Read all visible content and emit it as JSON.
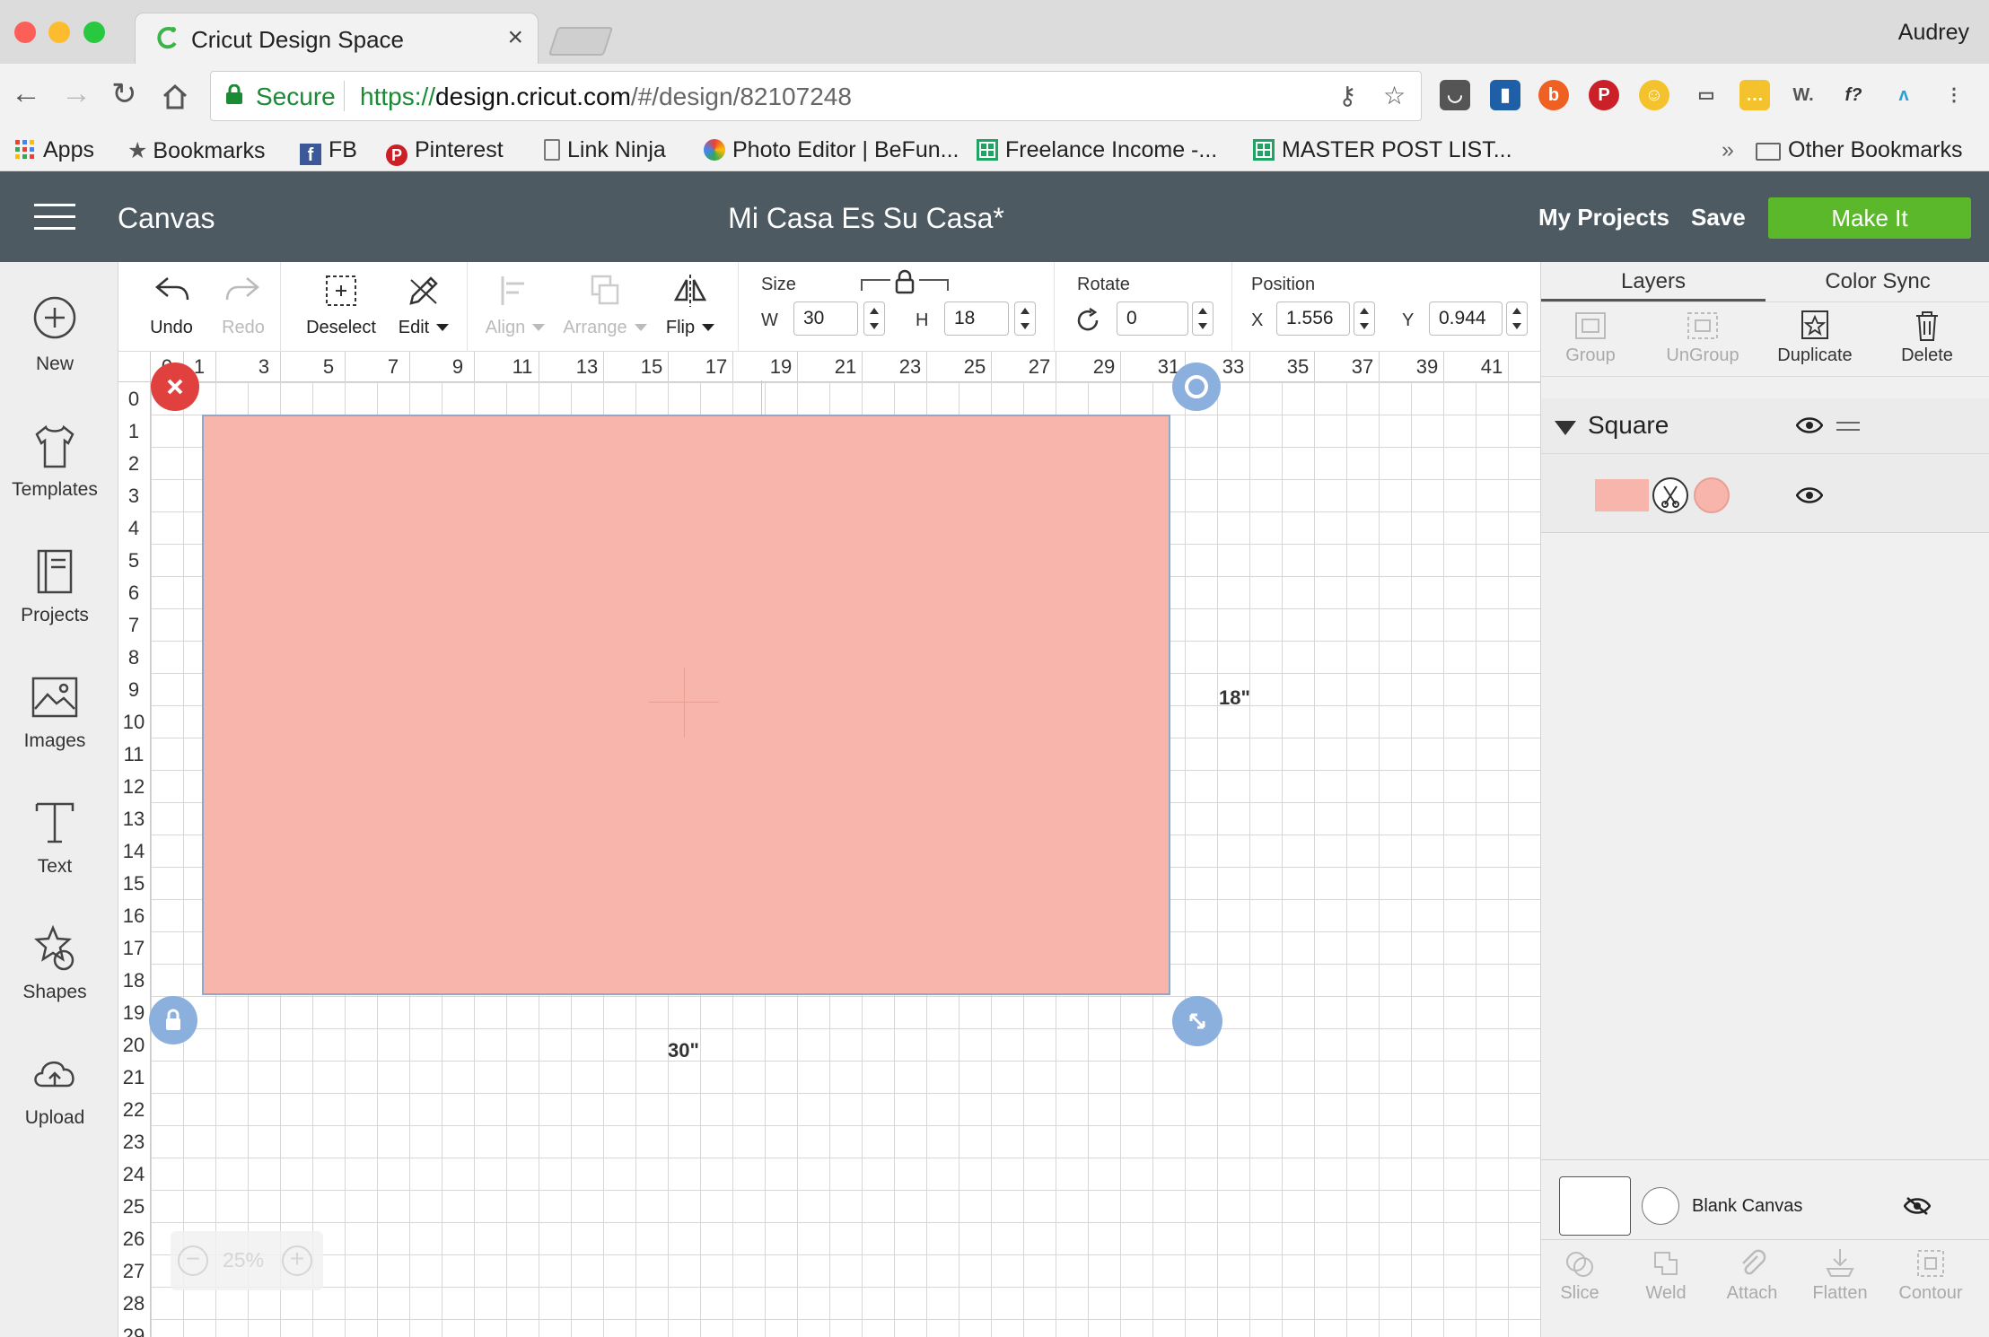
{
  "browser": {
    "tab_title": "Cricut Design Space",
    "profile_name": "Audrey",
    "address": {
      "secure_label": "Secure",
      "scheme": "https://",
      "host": "design.cricut.com",
      "path": "/#/design/82107248"
    },
    "bookmarks": [
      {
        "label": "Apps",
        "icon": "apps-grid-icon"
      },
      {
        "label": "Bookmarks",
        "icon": "star-icon"
      },
      {
        "label": "FB",
        "icon": "facebook-icon"
      },
      {
        "label": "Pinterest",
        "icon": "pinterest-icon"
      },
      {
        "label": "Link Ninja",
        "icon": "page-icon"
      },
      {
        "label": "Photo Editor | BeFun...",
        "icon": "befunky-icon"
      },
      {
        "label": "Freelance Income -...",
        "icon": "sheets-icon"
      },
      {
        "label": "MASTER POST LIST...",
        "icon": "sheets-icon"
      }
    ],
    "more_bookmarks": "»",
    "other_bookmarks": "Other Bookmarks"
  },
  "app": {
    "section_title": "Canvas",
    "project_name": "Mi Casa Es Su Casa*",
    "my_projects": "My Projects",
    "save": "Save",
    "make_it": "Make It",
    "colors": {
      "header": "#4d5a61",
      "make_it": "#5cb82b",
      "shape_fill": "#f7b5ab"
    }
  },
  "left_nav": [
    {
      "label": "New",
      "icon": "plus-circle-icon"
    },
    {
      "label": "Templates",
      "icon": "tshirt-icon"
    },
    {
      "label": "Projects",
      "icon": "book-icon"
    },
    {
      "label": "Images",
      "icon": "image-icon"
    },
    {
      "label": "Text",
      "icon": "text-t-icon"
    },
    {
      "label": "Shapes",
      "icon": "shapes-icon"
    },
    {
      "label": "Upload",
      "icon": "cloud-upload-icon"
    }
  ],
  "toolbar": {
    "undo": "Undo",
    "redo": "Redo",
    "deselect": "Deselect",
    "edit": "Edit",
    "align": "Align",
    "arrange": "Arrange",
    "flip": "Flip",
    "size_label": "Size",
    "w_label": "W",
    "w_value": "30",
    "h_label": "H",
    "h_value": "18",
    "rotate_label": "Rotate",
    "rotate_value": "0",
    "position_label": "Position",
    "x_label": "X",
    "x_value": "1.556",
    "y_label": "Y",
    "y_value": "0.944"
  },
  "canvas": {
    "ruler_x": [
      "0",
      "1",
      "3",
      "5",
      "7",
      "9",
      "11",
      "13",
      "15",
      "17",
      "19",
      "21",
      "23",
      "25",
      "27",
      "29",
      "31",
      "33",
      "35",
      "37",
      "39",
      "41"
    ],
    "ruler_y": [
      "0",
      "1",
      "2",
      "3",
      "4",
      "5",
      "6",
      "7",
      "8",
      "9",
      "10",
      "11",
      "12",
      "13",
      "14",
      "15",
      "16",
      "17",
      "18",
      "19",
      "20",
      "21",
      "22",
      "23",
      "24",
      "25",
      "26",
      "27",
      "28",
      "29"
    ],
    "width_dim": "30\"",
    "height_dim": "18\"",
    "zoom": "25%"
  },
  "layers_panel": {
    "tabs": [
      "Layers",
      "Color Sync"
    ],
    "actions": [
      {
        "label": "Group",
        "icon": "group-icon",
        "enabled": false
      },
      {
        "label": "UnGroup",
        "icon": "ungroup-icon",
        "enabled": false
      },
      {
        "label": "Duplicate",
        "icon": "duplicate-icon",
        "enabled": true
      },
      {
        "label": "Delete",
        "icon": "trash-icon",
        "enabled": true
      }
    ],
    "group_name": "Square",
    "blank_canvas": "Blank Canvas",
    "bottom_actions": [
      {
        "label": "Slice",
        "icon": "slice-icon"
      },
      {
        "label": "Weld",
        "icon": "weld-icon"
      },
      {
        "label": "Attach",
        "icon": "paperclip-icon"
      },
      {
        "label": "Flatten",
        "icon": "flatten-icon"
      },
      {
        "label": "Contour",
        "icon": "contour-icon"
      }
    ]
  }
}
